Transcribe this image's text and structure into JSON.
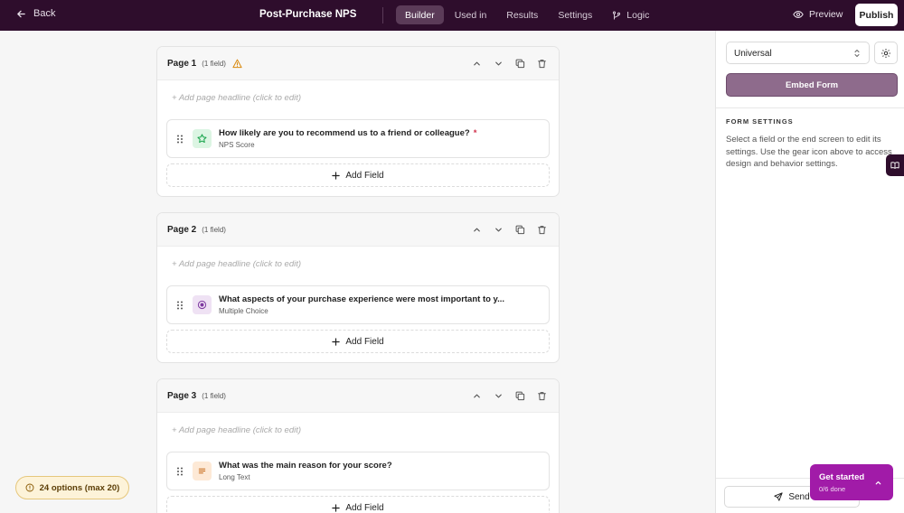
{
  "topbar": {
    "back_label": "Back",
    "form_title": "Post-Purchase NPS",
    "tabs": [
      {
        "label": "Builder",
        "active": true
      },
      {
        "label": "Used in",
        "active": false
      },
      {
        "label": "Results",
        "active": false
      },
      {
        "label": "Settings",
        "active": false
      },
      {
        "label": "Logic",
        "active": false,
        "icon": "branch-icon"
      }
    ],
    "preview_label": "Preview",
    "publish_label": "Publish"
  },
  "pages": [
    {
      "name": "Page 1",
      "count": "(1 field)",
      "has_warning": true,
      "headline_placeholder": "+ Add page headline (click to edit)",
      "field": {
        "question": "How likely are you to recommend us to a friend or colleague?",
        "required_mark": "*",
        "type": "NPS Score",
        "icon": "star-icon",
        "icon_color": "#16a34a",
        "icon_bg": "#dcf5e3"
      },
      "add_field_label": "Add Field"
    },
    {
      "name": "Page 2",
      "count": "(1 field)",
      "has_warning": false,
      "headline_placeholder": "+ Add page headline (click to edit)",
      "field": {
        "question": "What aspects of your purchase experience were most important to y...",
        "required_mark": "",
        "type": "Multiple Choice",
        "icon": "radio-icon",
        "icon_color": "#7e3aa0",
        "icon_bg": "#efe2f4"
      },
      "add_field_label": "Add Field"
    },
    {
      "name": "Page 3",
      "count": "(1 field)",
      "has_warning": false,
      "headline_placeholder": "+ Add page headline (click to edit)",
      "field": {
        "question": "What was the main reason for your score?",
        "required_mark": "",
        "type": "Long Text",
        "icon": "text-lines-icon",
        "icon_color": "#c2620e",
        "icon_bg": "#fde9d6"
      },
      "add_field_label": "Add Field"
    }
  ],
  "right_panel": {
    "platform_select": "Universal",
    "embed_label": "Embed Form",
    "form_settings_title": "FORM SETTINGS",
    "form_settings_desc": "Select a field or the end screen to edit its settings. Use the gear icon above to access design and behavior settings.",
    "send_label": "Send"
  },
  "get_started": {
    "title": "Get started",
    "progress": "0/6 done"
  },
  "options_warning": "24 options (max 20)",
  "colors": {
    "topbar_bg": "#2e0d2c",
    "accent": "#a11ba8",
    "embed_bg": "#8e6b8c",
    "warning": "#e6a23c"
  }
}
